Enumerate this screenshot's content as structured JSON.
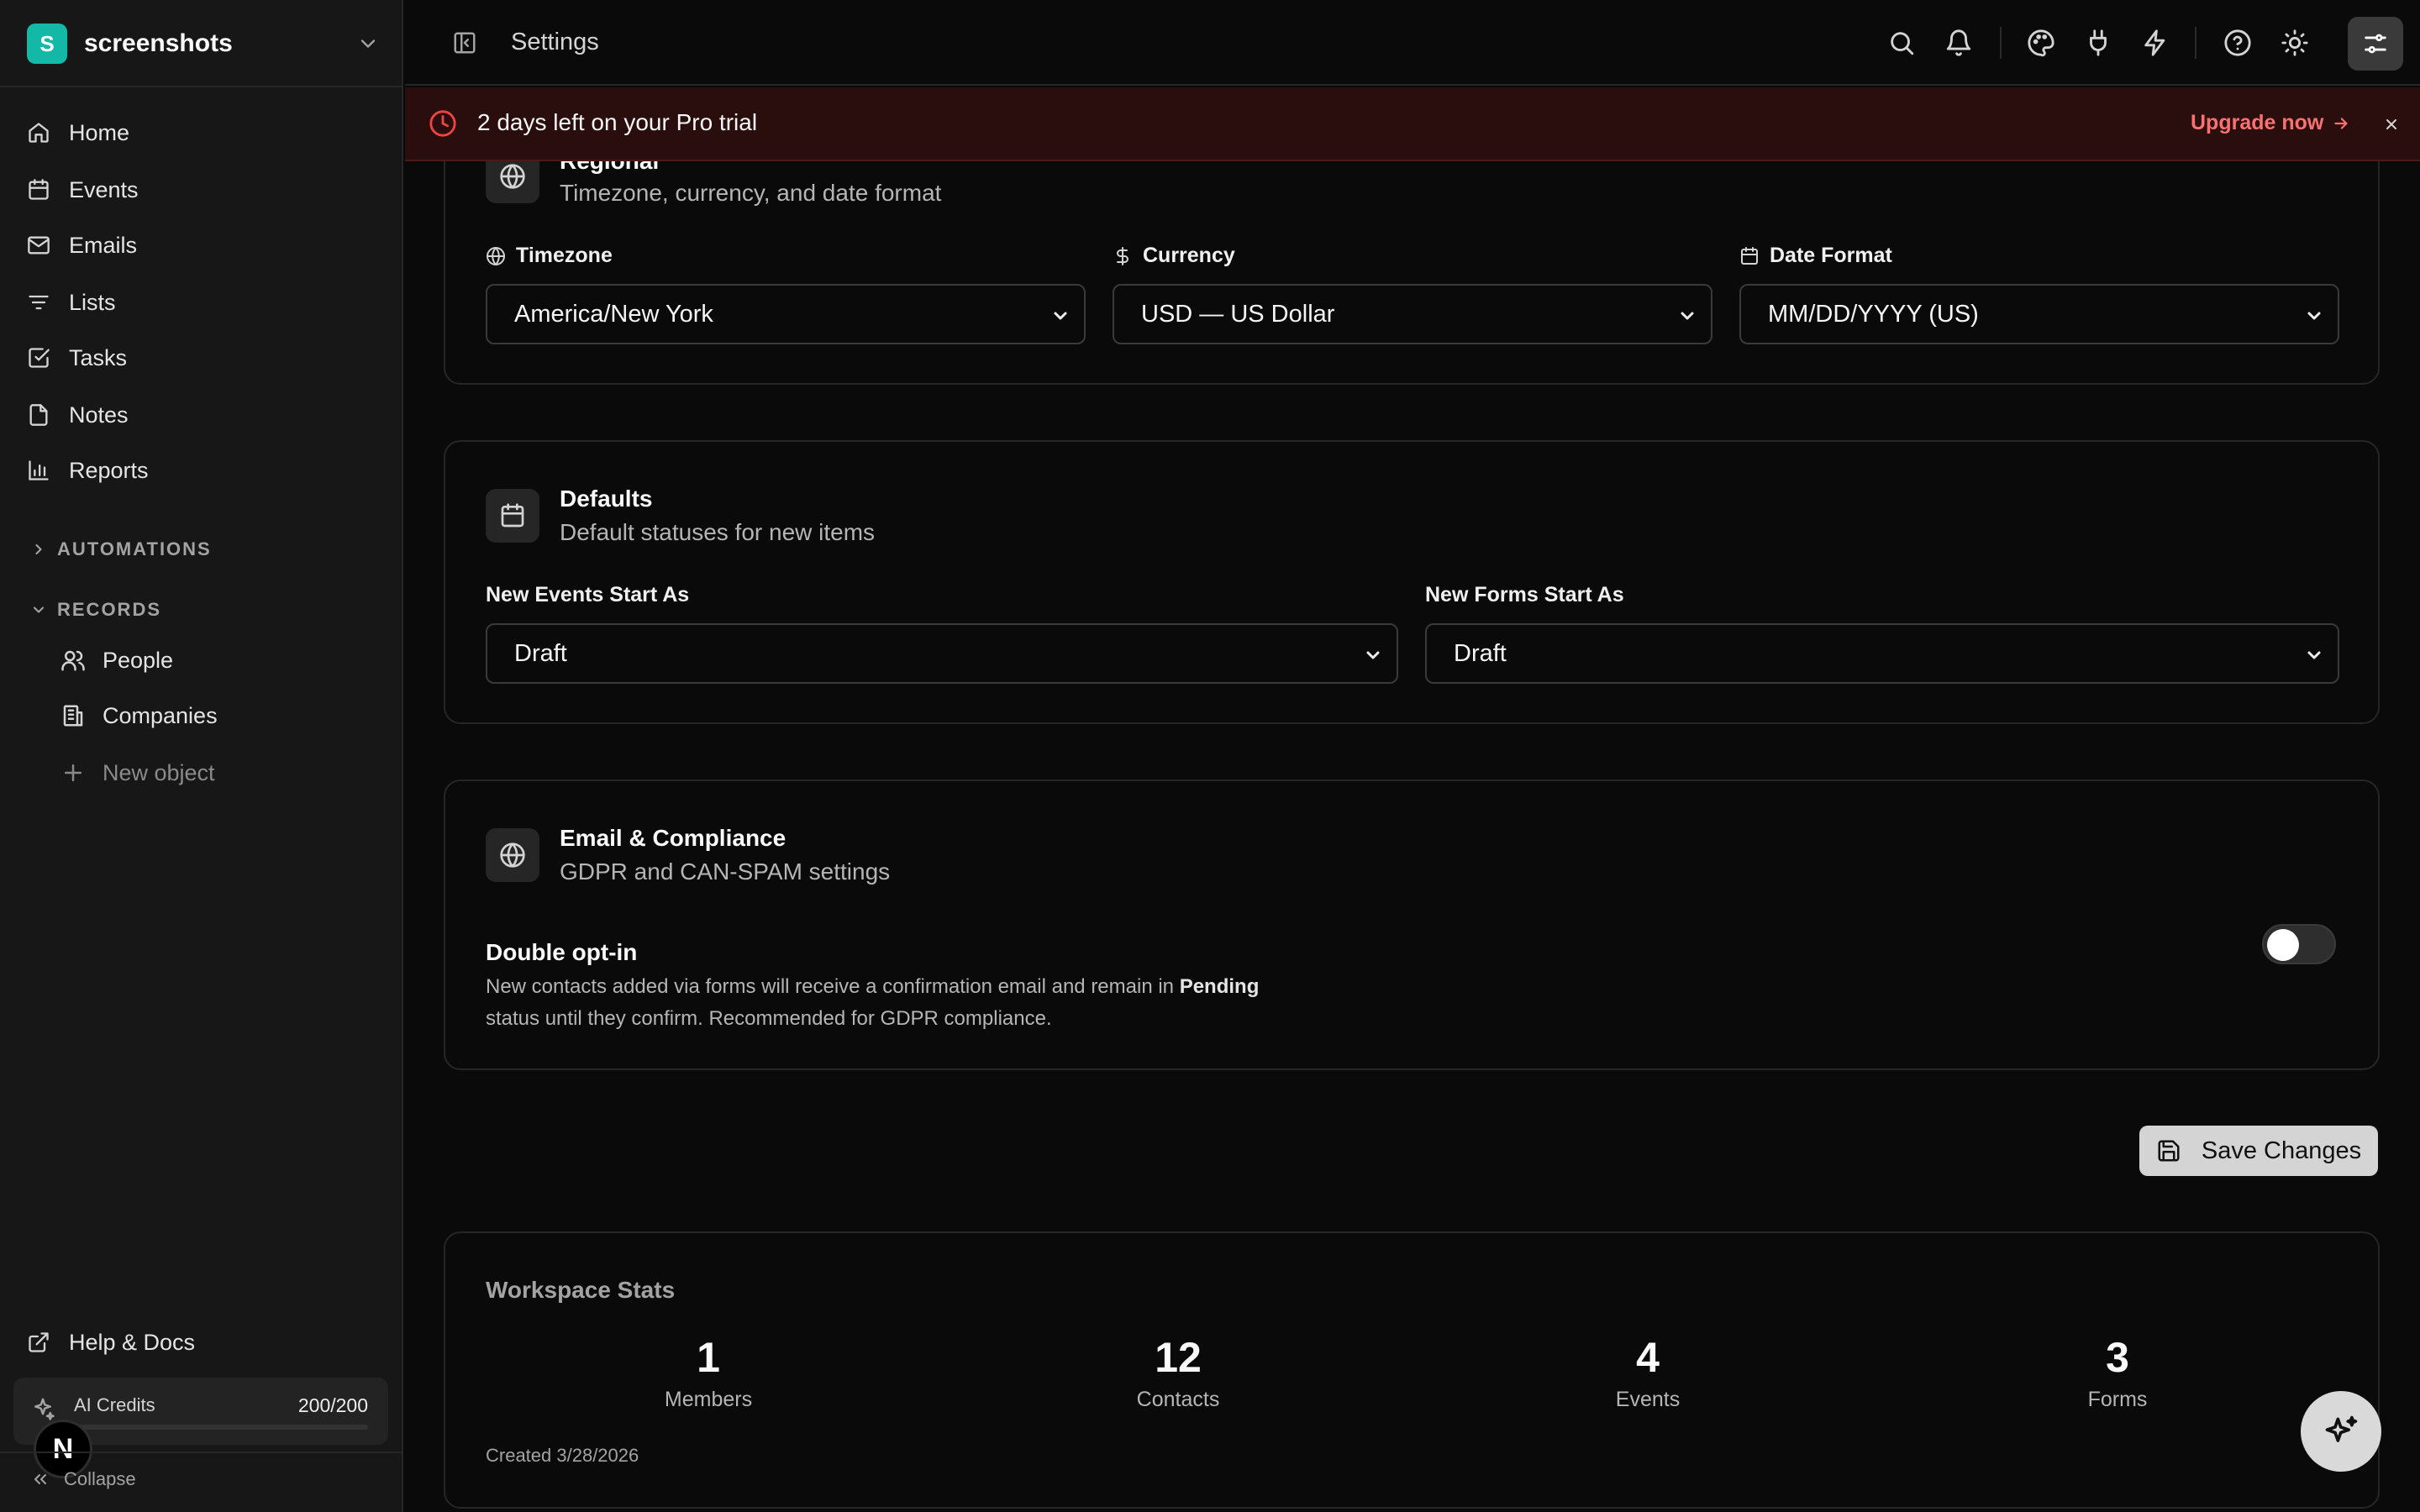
{
  "workspace": {
    "initial": "S",
    "name": "screenshots"
  },
  "nav": [
    {
      "label": "Home",
      "icon": "home-icon"
    },
    {
      "label": "Events",
      "icon": "calendar-icon"
    },
    {
      "label": "Emails",
      "icon": "mail-icon"
    },
    {
      "label": "Lists",
      "icon": "list-filter-icon"
    },
    {
      "label": "Tasks",
      "icon": "check-square-icon"
    },
    {
      "label": "Notes",
      "icon": "file-icon"
    },
    {
      "label": "Reports",
      "icon": "bar-chart-icon"
    }
  ],
  "sections": {
    "automations": "AUTOMATIONS",
    "records": "RECORDS"
  },
  "records": [
    {
      "label": "People",
      "icon": "users-icon"
    },
    {
      "label": "Companies",
      "icon": "building-icon"
    }
  ],
  "new_object": "New object",
  "help": "Help & Docs",
  "credits": {
    "label": "AI Credits",
    "value": "200/200",
    "used_fraction": 0.0
  },
  "user_badge": "N",
  "collapse": "Collapse",
  "topbar": {
    "title": "Settings"
  },
  "banner": {
    "text": "2 days left on your Pro trial",
    "link": "Upgrade now"
  },
  "regional": {
    "title": "Regional",
    "subtitle": "Timezone, currency, and date format",
    "fields": [
      {
        "label": "Timezone",
        "value": "America/New York"
      },
      {
        "label": "Currency",
        "value": "USD — US Dollar"
      },
      {
        "label": "Date Format",
        "value": "MM/DD/YYYY (US)"
      }
    ]
  },
  "defaults": {
    "title": "Defaults",
    "subtitle": "Default statuses for new items",
    "fields": [
      {
        "label": "New Events Start As",
        "value": "Draft"
      },
      {
        "label": "New Forms Start As",
        "value": "Draft"
      }
    ]
  },
  "email": {
    "title": "Email & Compliance",
    "subtitle": "GDPR and CAN-SPAM settings",
    "option_title": "Double opt-in",
    "desc_1": "New contacts added via forms will receive a confirmation email and remain in",
    "desc_bold": "Pending",
    "desc_2": "status until they confirm. Recommended for GDPR compliance.",
    "enabled": false
  },
  "save_label": "Save Changes",
  "stats": {
    "title": "Workspace Stats",
    "items": [
      {
        "value": "1",
        "label": "Members"
      },
      {
        "value": "12",
        "label": "Contacts"
      },
      {
        "value": "4",
        "label": "Events"
      },
      {
        "value": "3",
        "label": "Forms"
      }
    ],
    "created": "Created 3/28/2026"
  },
  "colors": {
    "accent": "#14b8a6",
    "banner_bg": "#2a0e0e",
    "banner_link": "#f87171"
  }
}
